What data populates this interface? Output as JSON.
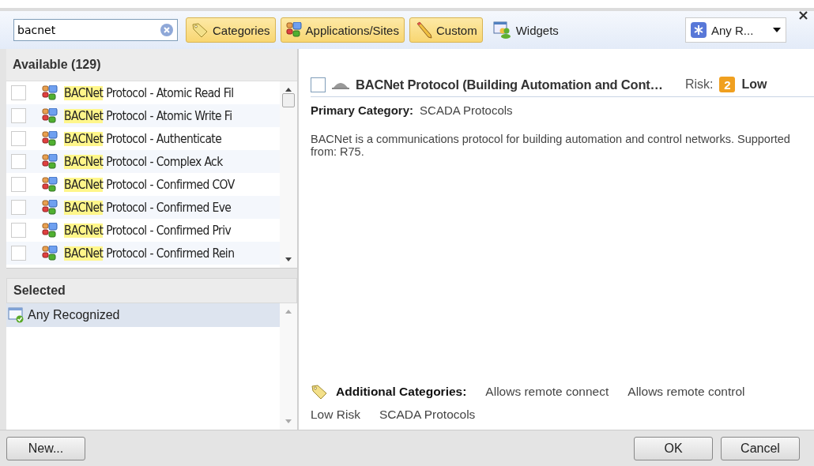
{
  "toolbar": {
    "search": {
      "value": "bacnet"
    },
    "filters": [
      {
        "label": "Categories",
        "kind": "tag",
        "selected": true
      },
      {
        "label": "Applications/Sites",
        "kind": "apps",
        "selected": true
      },
      {
        "label": "Custom",
        "kind": "pencil",
        "selected": true
      },
      {
        "label": "Widgets",
        "kind": "widgets",
        "selected": false
      }
    ],
    "dropdown": {
      "value": "Any R..."
    }
  },
  "available": {
    "title": "Available (129)",
    "rows": [
      {
        "match": "BACNet",
        "rest": "Protocol - Atomic Read Fil",
        "checked": false
      },
      {
        "match": "BACNet",
        "rest": "Protocol - Atomic Write Fi",
        "checked": false
      },
      {
        "match": "BACNet",
        "rest": "Protocol - Authenticate",
        "checked": false
      },
      {
        "match": "BACNet",
        "rest": "Protocol - Complex Ack",
        "checked": false
      },
      {
        "match": "BACNet",
        "rest": "Protocol - Confirmed COV",
        "checked": false
      },
      {
        "match": "BACNet",
        "rest": "Protocol - Confirmed Eve",
        "checked": false
      },
      {
        "match": "BACNet",
        "rest": "Protocol - Confirmed Priv",
        "checked": false
      },
      {
        "match": "BACNet",
        "rest": "Protocol - Confirmed Rein",
        "checked": false
      }
    ]
  },
  "selected_list": {
    "title": "Selected",
    "items": [
      {
        "label": "Any Recognized",
        "selected": true
      }
    ]
  },
  "detail": {
    "checked": false,
    "title": "BACNet Protocol (Building Automation and Cont…",
    "risk_label": "Risk:",
    "risk_level": "2",
    "risk_text": "Low",
    "primary_category_label": "Primary Category:",
    "primary_category": "SCADA Protocols",
    "description": "BACNet is a communications protocol for building automation and control networks. Supported from: R75.",
    "additional_label": "Additional Categories:",
    "additional": [
      "Allows remote connect",
      "Allows remote control",
      "Low Risk",
      "SCADA Protocols"
    ]
  },
  "buttons": {
    "new": "New...",
    "ok": "OK",
    "cancel": "Cancel"
  }
}
